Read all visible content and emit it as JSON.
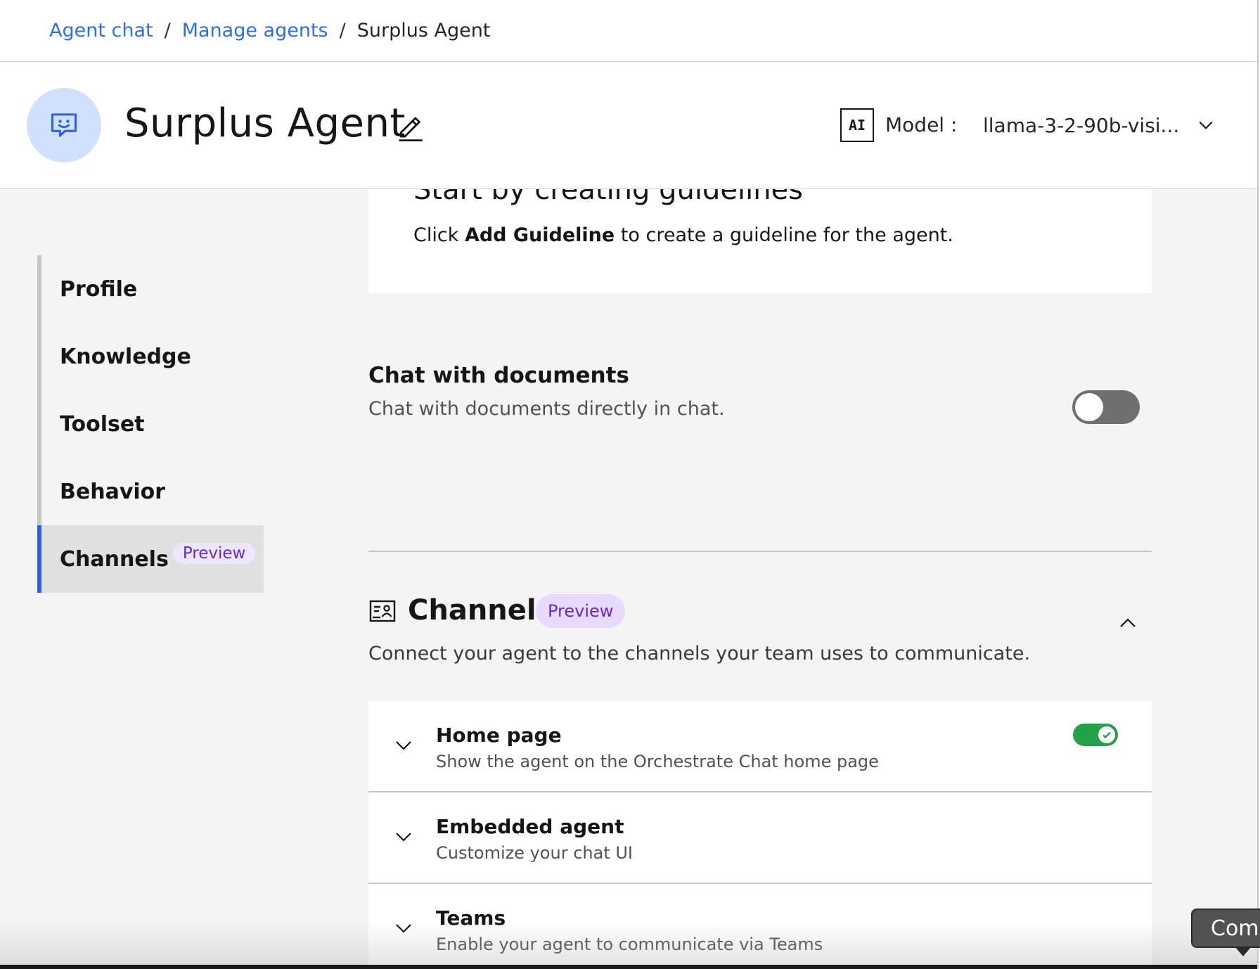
{
  "breadcrumb": {
    "items": [
      "Agent chat",
      "Manage agents"
    ],
    "separator": "/",
    "current": "Surplus Agent"
  },
  "header": {
    "agent_name": "Surplus Agent",
    "avatar_icon": "chat-bot-icon",
    "edit_icon": "pencil-icon",
    "ai_badge": "AI",
    "model_label": "Model :",
    "model_value": "llama-3-2-90b-visi..."
  },
  "nav": {
    "items": [
      {
        "label": "Profile"
      },
      {
        "label": "Knowledge"
      },
      {
        "label": "Toolset"
      },
      {
        "label": "Behavior"
      },
      {
        "label": "Channels",
        "tag": "Preview",
        "active": true
      }
    ]
  },
  "guidelines": {
    "heading": "Start by creating guidelines",
    "text_prefix": "Click",
    "text_bold": "Add Guideline",
    "text_suffix": "to create a guideline for the agent."
  },
  "chat_with_documents": {
    "title": "Chat with documents",
    "description": "Chat with documents directly in chat.",
    "enabled": false
  },
  "channels": {
    "icon": "channels-icon",
    "title": "Channels",
    "tag": "Preview",
    "description": "Connect your agent to the channels your team uses to communicate.",
    "rows": [
      {
        "title": "Home page",
        "description": "Show the agent on the Orchestrate Chat home page",
        "enabled": true
      },
      {
        "title": "Embedded agent",
        "description": "Customize your chat UI"
      },
      {
        "title": "Teams",
        "description": "Enable your agent to communicate via Teams"
      }
    ]
  },
  "tooltip": {
    "text": "Come"
  },
  "colors": {
    "link": "#2f6fe0",
    "accent": "#2f5fe8",
    "toggle_on": "#24a148",
    "tag_bg": "#e8daff",
    "tag_text": "#6929c4"
  }
}
